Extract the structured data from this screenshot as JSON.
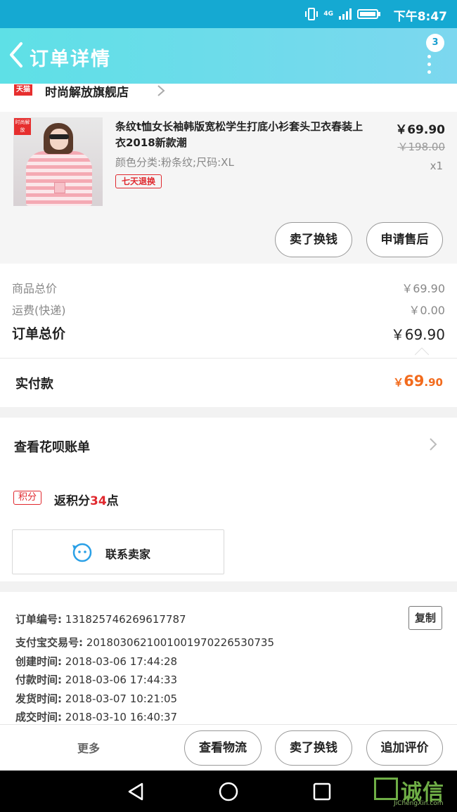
{
  "status_bar": {
    "network": "4G",
    "time": "下午8:47"
  },
  "header": {
    "title": "订单详情",
    "badge": "3"
  },
  "shop": {
    "platform_badge": "天猫",
    "name": "时尚解放旗舰店"
  },
  "product": {
    "thumb_tag": "时尚解放",
    "title": "条纹t恤女长袖韩版宽松学生打底小衫套头卫衣春装上衣2018新款潮",
    "spec": "颜色分类:粉条纹;尺码:XL",
    "return_tag": "七天退换",
    "price": "￥69.90",
    "original_price": "￥198.00",
    "qty": "x1",
    "btn_refund": "卖了换钱",
    "btn_aftersale": "申请售后"
  },
  "summary": {
    "goods_label": "商品总价",
    "goods_value": "￥69.90",
    "ship_label": "运费(快递)",
    "ship_value": "￥0.00",
    "total_label": "订单总价",
    "total_value": "￥69.90"
  },
  "paid": {
    "label": "实付款",
    "currency": "￥",
    "int": "69",
    "dec": ".90"
  },
  "huabei": {
    "link": "查看花呗账单"
  },
  "points": {
    "badge": "积分",
    "prefix": "返积分",
    "num": "34",
    "suffix": "点"
  },
  "contact": {
    "label": "联系卖家"
  },
  "info": {
    "order_no_label": "订单编号:",
    "order_no": "131825746269617787",
    "alipay_label": "支付宝交易号:",
    "alipay": "2018030621001001970226530735",
    "created_label": "创建时间:",
    "created": "2018-03-06 17:44:28",
    "paid_label": "付款时间:",
    "paid": "2018-03-06 17:44:33",
    "shipped_label": "发货时间:",
    "shipped": "2018-03-07 10:21:05",
    "deal_label": "成交时间:",
    "deal": "2018-03-10 16:40:37",
    "copy": "复制"
  },
  "bottom": {
    "more": "更多",
    "logistics": "查看物流",
    "resell": "卖了换钱",
    "review": "追加评价"
  },
  "watermark": {
    "cn": "诚信",
    "en": "JiChengXin.com"
  },
  "colors": {
    "header": "#6fdaeb",
    "price_accent": "#f26b1d",
    "red": "#e0282e"
  }
}
